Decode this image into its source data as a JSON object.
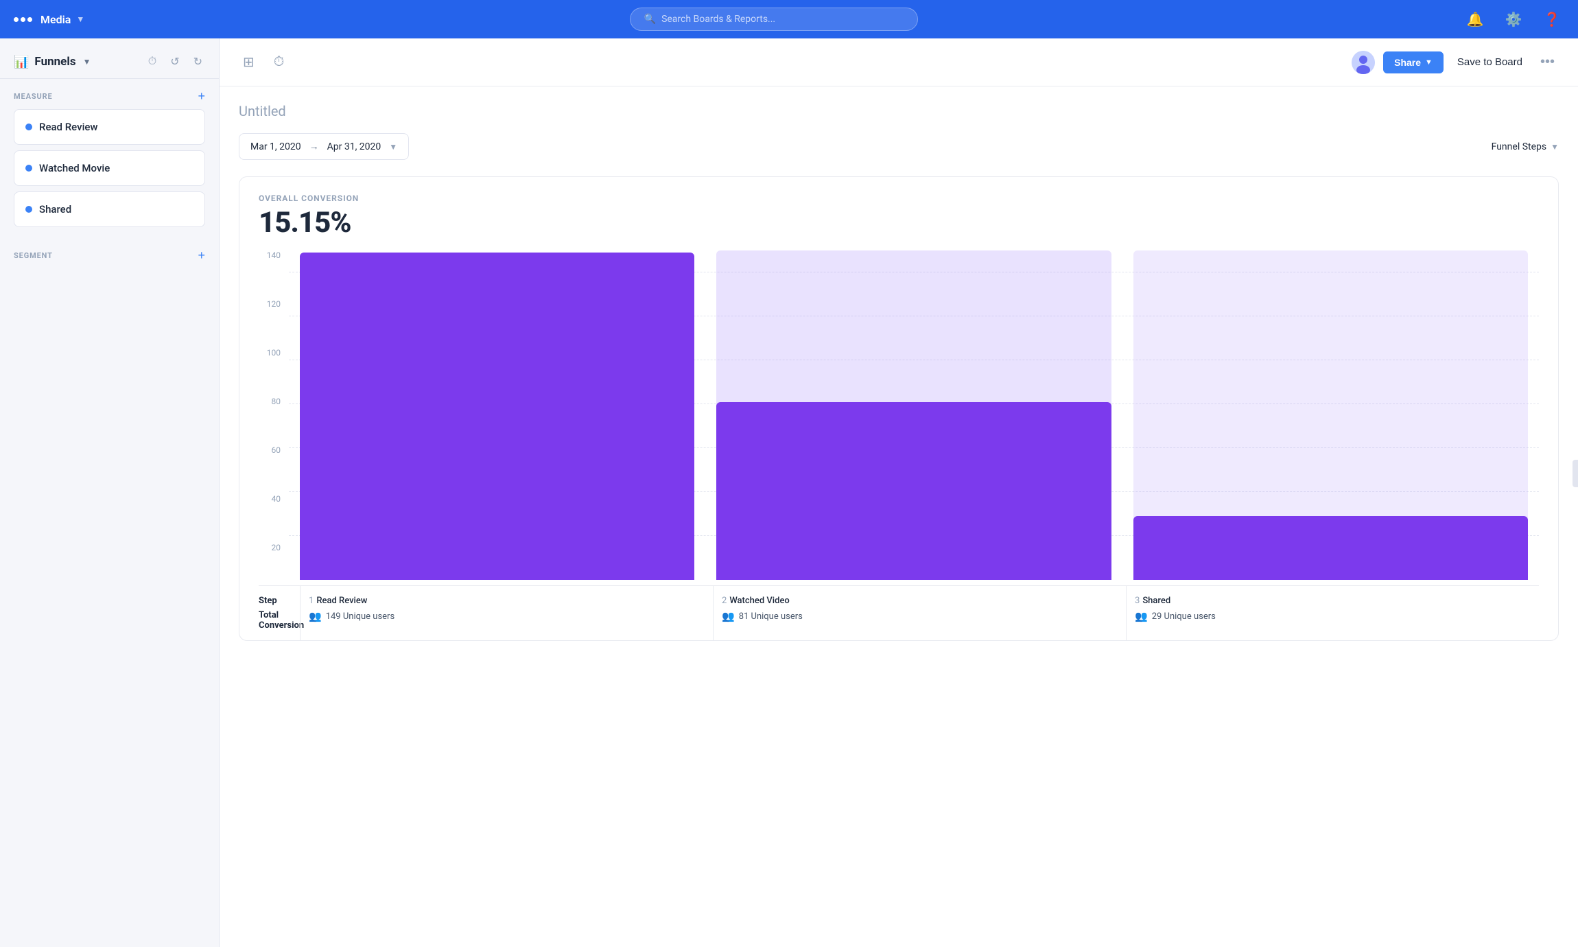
{
  "navbar": {
    "app_name": "Media",
    "search_placeholder": "Search Boards & Reports...",
    "nav_dots": [
      "dot1",
      "dot2",
      "dot3"
    ]
  },
  "sidebar": {
    "title": "Funnels",
    "section_measure": "MEASURE",
    "section_segment": "SEGMENT",
    "measures": [
      {
        "id": 1,
        "label": "Read Review",
        "color": "#3b82f6"
      },
      {
        "id": 2,
        "label": "Watched Movie",
        "color": "#3b82f6"
      },
      {
        "id": 3,
        "label": "Shared",
        "color": "#3b82f6"
      }
    ]
  },
  "toolbar": {
    "share_label": "Share",
    "save_board_label": "Save to Board"
  },
  "report": {
    "title": "Untitled",
    "date_start": "Mar 1, 2020",
    "date_end": "Apr 31, 2020",
    "funnel_steps_label": "Funnel Steps",
    "overall_conversion_label": "OVERALL CONVERSION",
    "overall_pct": "15.15%",
    "y_labels": [
      "20",
      "40",
      "60",
      "80",
      "100",
      "120",
      "140"
    ],
    "steps": [
      {
        "num": "1",
        "name": "Read Review",
        "unique_users": "149 Unique users",
        "bar_height_pct": 100,
        "bar_bg_color": "#7c3aed",
        "bar_bg_opacity": 1
      },
      {
        "num": "2",
        "name": "Watched Video",
        "unique_users": "81 Unique users",
        "bar_height_pct": 54,
        "bar_bg_color": "#a78bfa",
        "bar_bg_opacity": 0.35
      },
      {
        "num": "3",
        "name": "Shared",
        "unique_users": "29 Unique users",
        "bar_height_pct": 19,
        "bar_bg_color": "#a78bfa",
        "bar_bg_opacity": 0.25
      }
    ]
  }
}
